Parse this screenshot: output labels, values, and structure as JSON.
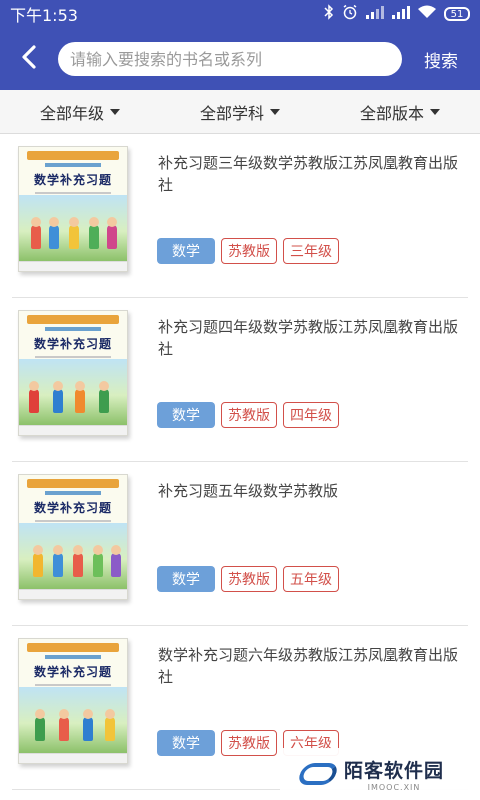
{
  "status": {
    "time": "下午1:53",
    "battery": "51",
    "icons": [
      "bluetooth-icon",
      "alarm-icon",
      "signal-icon",
      "signal-icon",
      "wifi-icon",
      "battery-icon"
    ]
  },
  "toolbar": {
    "back_icon": "back-arrow-icon",
    "search_placeholder": "请输入要搜索的书名或系列",
    "search_value": "",
    "search_label": "搜索"
  },
  "filters": [
    {
      "label": "全部年级"
    },
    {
      "label": "全部学科"
    },
    {
      "label": "全部版本"
    }
  ],
  "books": [
    {
      "title": "补充习题三年级数学苏教版江苏凤凰教育出版社",
      "subject": "数学",
      "edition": "苏教版",
      "grade": "三年级",
      "cover_title": "数学补充习题"
    },
    {
      "title": "补充习题四年级数学苏教版江苏凤凰教育出版社",
      "subject": "数学",
      "edition": "苏教版",
      "grade": "四年级",
      "cover_title": "数学补充习题"
    },
    {
      "title": "补充习题五年级数学苏教版",
      "subject": "数学",
      "edition": "苏教版",
      "grade": "五年级",
      "cover_title": "数学补充习题"
    },
    {
      "title": "数学补充习题六年级苏教版江苏凤凰教育出版社",
      "subject": "数学",
      "edition": "苏教版",
      "grade": "六年级",
      "cover_title": "数学补充习题"
    }
  ],
  "watermark": {
    "name": "陌客软件园",
    "url": "IMOOC.XIN"
  },
  "colors": {
    "primary": "#3f51b5",
    "subject_tag": "#6da0d9",
    "outline_tag": "#d2504a"
  }
}
